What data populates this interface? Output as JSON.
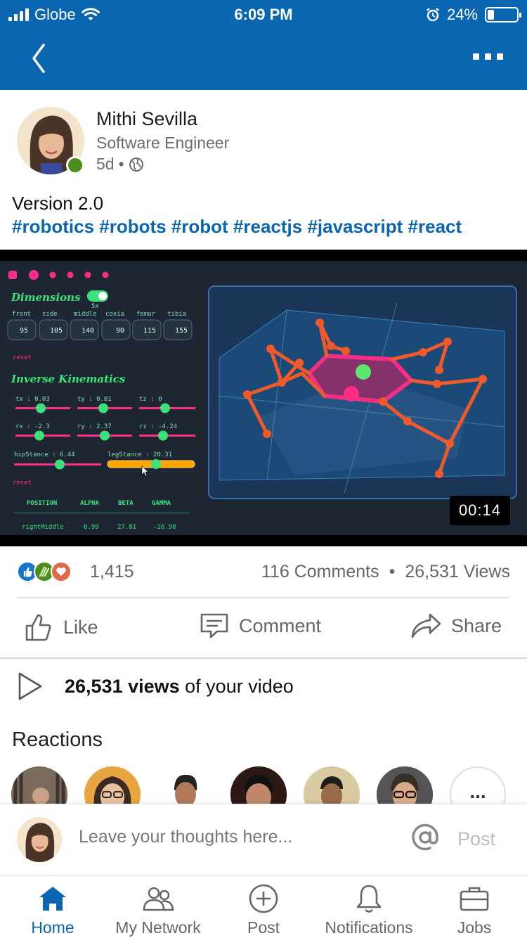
{
  "status_bar": {
    "carrier": "Globe",
    "time": "6:09 PM",
    "battery": "24%",
    "battery_level": 0.24
  },
  "nav": {
    "back_icon": "chevron-left-icon",
    "more_icon": "more-horizontal-icon"
  },
  "author": {
    "name": "Mithi Sevilla",
    "title": "Software Engineer",
    "age": "5d",
    "separator": "•",
    "visibility_icon": "globe-icon",
    "online": true
  },
  "post": {
    "text": "Version 2.0",
    "hashtags": "#robotics #robots #robot #reactjs #javascript #react"
  },
  "video": {
    "duration": "00:14",
    "ui": {
      "dimensions_title": "Dimensions",
      "dim_labels": [
        "front",
        "side",
        "middle",
        "coxia",
        "femur",
        "tibia"
      ],
      "dim_step": "5x",
      "dim_values": [
        "95",
        "105",
        "140",
        "90",
        "115",
        "155"
      ],
      "reset": "reset",
      "ik_title": "Inverse Kinematics",
      "sliders": [
        {
          "label": "tx : 0.03",
          "pos": 0.45
        },
        {
          "label": "ty : 0.01",
          "pos": 0.5
        },
        {
          "label": "tz : 0",
          "pos": 0.5
        },
        {
          "label": "rx : -2.3",
          "pos": 0.45
        },
        {
          "label": "ry : 2.37",
          "pos": 0.5
        },
        {
          "label": "rz : -4.24",
          "pos": 0.45
        },
        {
          "label": "hipStance : 6.44",
          "pos": 0.5
        },
        {
          "label": "legStance : 20.31",
          "pos": 0.55
        }
      ],
      "table_headers": [
        "POSITION",
        "ALPHA",
        "BETA",
        "GAMMA"
      ],
      "table_row": [
        "rightMiddle",
        "6.99",
        "27.81",
        "-26.98"
      ]
    }
  },
  "stats": {
    "reaction_count": "1,415",
    "comments": "116 Comments",
    "separator": "•",
    "views": "26,531 Views",
    "reaction_colors": [
      "#1a75c9",
      "#4a8f1e",
      "#e06a4b"
    ]
  },
  "actions": {
    "like": "Like",
    "comment": "Comment",
    "share": "Share"
  },
  "views_line": {
    "bold": "26,531 views",
    "rest": "of your video"
  },
  "reactions_section": {
    "title": "Reactions",
    "more": "..."
  },
  "comment_bar": {
    "placeholder": "Leave your thoughts here...",
    "post_label": "Post"
  },
  "tabbar": {
    "home": "Home",
    "network": "My Network",
    "post": "Post",
    "notifications": "Notifications",
    "jobs": "Jobs"
  },
  "colors": {
    "brand": "#0a66b0",
    "accent_pink": "#ff2d86",
    "accent_green": "#39e27a",
    "robot_orange": "#f05a2a"
  }
}
